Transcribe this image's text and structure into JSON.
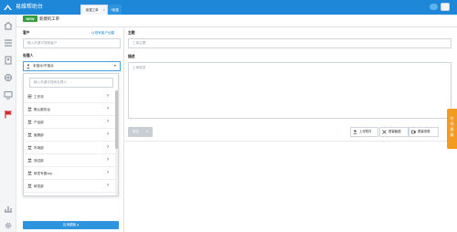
{
  "app": {
    "title": "易维帮助台"
  },
  "tabs": [
    {
      "label": "新建工单",
      "close": "×"
    },
    {
      "label": "+新建"
    }
  ],
  "section": {
    "tag": "NEW",
    "title": "新建的工单"
  },
  "customer": {
    "label": "客户",
    "link": "以现有客户创建",
    "placeholder": "输入关键字搜索客户"
  },
  "assignee": {
    "label": "处理人",
    "value": "未指派/不指派",
    "caret": "▾"
  },
  "dropdown": {
    "search_placeholder": "输入关键字搜索处理人",
    "items": [
      {
        "label": "工作流"
      },
      {
        "label": "默认服务台"
      },
      {
        "label": "产品部"
      },
      {
        "label": "客服部"
      },
      {
        "label": "市场部"
      },
      {
        "label": "测试部"
      },
      {
        "label": "研发专属zzp"
      },
      {
        "label": "研发部"
      }
    ],
    "arrow": "›"
  },
  "apply_button": "应用模板 ▴",
  "subject": {
    "label": "主题",
    "placeholder": "工单主题"
  },
  "description": {
    "label": "描述",
    "placeholder": "工单描述"
  },
  "submit": {
    "label": "提交",
    "caret": "▾"
  },
  "tools": {
    "upload": "上传附件",
    "screenshot": "屏幕截图",
    "record": "屏幕录像"
  },
  "float_tab": "在线客服",
  "colors": {
    "brand": "#1e87d7",
    "new_tag": "#2e9e3e",
    "float": "#f39a21"
  }
}
